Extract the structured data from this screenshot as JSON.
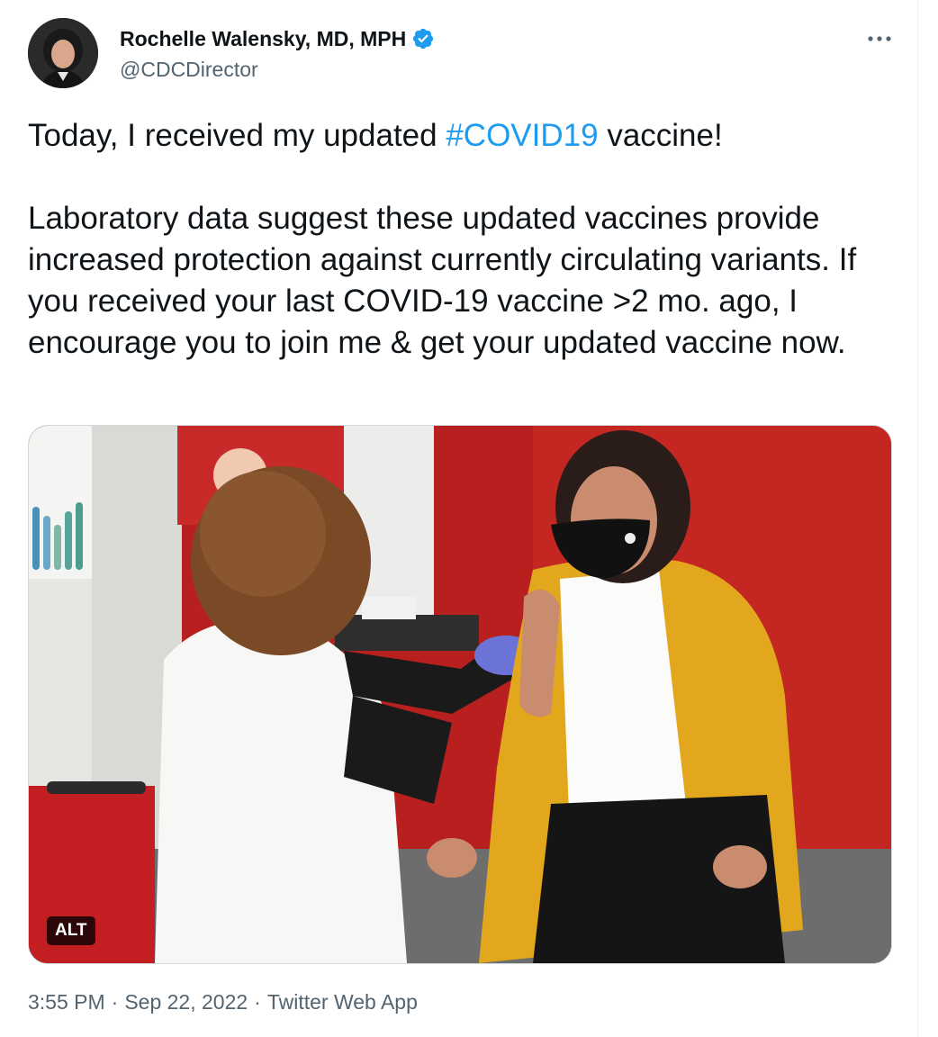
{
  "author": {
    "display_name": "Rochelle Walensky, MD, MPH",
    "handle": "@CDCDirector",
    "verified": true,
    "verified_icon": "verified-badge-icon",
    "avatar_icon": "avatar-photo"
  },
  "menu": {
    "icon": "more-horizontal-icon"
  },
  "tweet": {
    "line1_before": "Today, I received my updated ",
    "hashtag": "#COVID19",
    "line1_after": " vaccine!",
    "body": "Laboratory data suggest these updated vaccines provide increased protection against currently circulating variants. If you received your last COVID-19 vaccine >2 mo. ago, I encourage you to join me & get your updated vaccine now."
  },
  "media": {
    "alt_label": "ALT",
    "description_icon": "photo-of-vaccination"
  },
  "meta": {
    "time": "3:55 PM",
    "separator": "·",
    "date": "Sep 22, 2022",
    "source": "Twitter Web App"
  },
  "colors": {
    "text": "#0f1419",
    "secondary": "#536471",
    "link": "#1d9bf0",
    "border": "#cfd9de"
  }
}
